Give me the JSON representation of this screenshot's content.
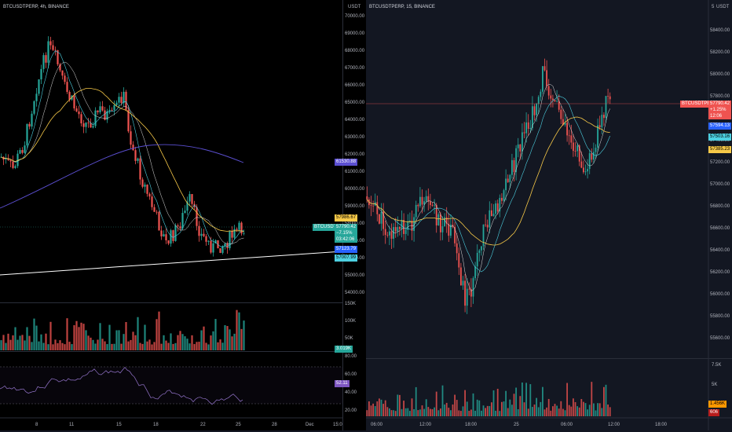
{
  "left": {
    "title": "BTCUSDTPERP, 4h, BINANCE",
    "currency": "USDT",
    "price_axis": [
      "70000.00",
      "69000.00",
      "68000.00",
      "67000.00",
      "66000.00",
      "65000.00",
      "64000.00",
      "63000.00",
      "62000.00",
      "61000.00",
      "60000.00",
      "59000.00",
      "58000.00",
      "57000.00",
      "56000.00",
      "55000.00",
      "54000.00"
    ],
    "tags": {
      "ma200": "61530.88",
      "ma50": "57986.67",
      "symbol": "BTCUSDTPERP",
      "price": "57790.42",
      "change": "−7.15%",
      "countdown": "03:42:06",
      "ma20": "57123.79",
      "ma9": "57007.99"
    },
    "volume_axis": [
      "150K",
      "100K",
      "50K"
    ],
    "volume_tag": "3.019K",
    "rsi_axis": [
      "80.00",
      "60.00",
      "40.00",
      "20.00"
    ],
    "rsi_tag": "52.11",
    "time_axis": [
      "8",
      "11",
      "15",
      "18",
      "22",
      "25",
      "28",
      "Dec",
      "15:0"
    ]
  },
  "right": {
    "title": "BTCUSDTPERP, 15, BINANCE",
    "currency": "USDT",
    "corner": "5",
    "price_axis": [
      "58400.00",
      "58200.00",
      "58000.00",
      "57800.00",
      "57600.00",
      "57400.00",
      "57200.00",
      "57000.00",
      "56800.00",
      "56600.00",
      "56400.00",
      "56200.00",
      "56000.00",
      "55800.00",
      "55600.00"
    ],
    "tags": {
      "symbol": "BTCUSDTPERP",
      "price": "57790.42",
      "change": "+1.25%",
      "countdown": "12:06",
      "ma9": "57594.13",
      "ma20": "57503.16",
      "ma50": "57385.23"
    },
    "volume_axis": [
      "7.5K",
      "5K",
      "2.5K"
    ],
    "volume_tags": [
      "1.456K",
      "606"
    ],
    "time_axis": [
      "06:00",
      "12:00",
      "18:00",
      "25",
      "06:00",
      "12:00",
      "18:00"
    ]
  },
  "colors": {
    "up": "#26a69a",
    "down": "#ef5350",
    "ma_yellow": "#f7c948",
    "ma_purple": "#5b4fd1",
    "ma_cyan": "#4dd0e1",
    "ma_white": "#e0e0e0"
  }
}
